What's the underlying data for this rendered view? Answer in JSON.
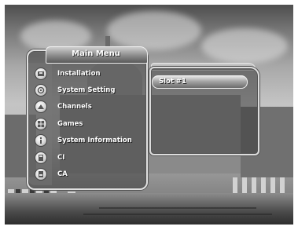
{
  "main_menu": {
    "title": "Main Menu",
    "items": [
      {
        "label": "Installation",
        "icon": "installation-icon"
      },
      {
        "label": "System Setting",
        "icon": "system-setting-icon"
      },
      {
        "label": "Channels",
        "icon": "channels-icon"
      },
      {
        "label": "Games",
        "icon": "games-icon"
      },
      {
        "label": "System Information",
        "icon": "system-information-icon"
      },
      {
        "label": "CI",
        "icon": "ci-icon"
      },
      {
        "label": "CA",
        "icon": "ca-icon"
      }
    ]
  },
  "sub_menu": {
    "items": [
      {
        "label": "Slot #1",
        "selected": true
      }
    ]
  }
}
